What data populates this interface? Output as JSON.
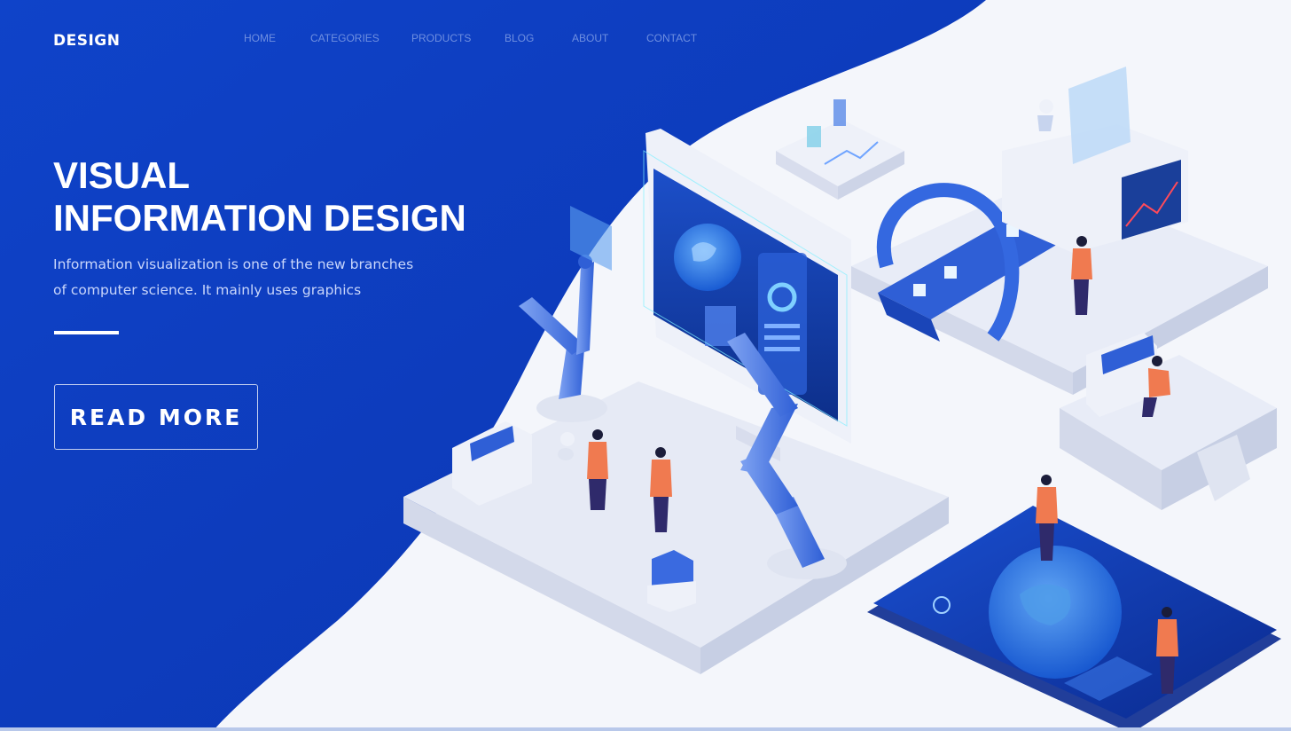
{
  "brand": {
    "logo": "DESIGN"
  },
  "nav": {
    "items": [
      {
        "label": "HOME"
      },
      {
        "label": "CATEGORIES"
      },
      {
        "label": "PRODUCTS"
      },
      {
        "label": "BLOG"
      },
      {
        "label": "ABOUT"
      },
      {
        "label": "CONTACT"
      }
    ]
  },
  "hero": {
    "title_line1": "VISUAL",
    "title_line2": "INFORMATION DESIGN",
    "description_line1": "Information visualization is one of the new branches",
    "description_line2": "of computer science. It mainly uses graphics",
    "cta_label": "READ MORE"
  },
  "colors": {
    "primary_blue": "#0e3fc4",
    "light_bg": "#f4f6fb",
    "accent_orange": "#f07a50"
  },
  "illustration": {
    "icons": [
      "monitor-icon",
      "robot-arm-icon",
      "globe-icon",
      "conveyor-arch-icon",
      "person-icon",
      "chart-panel-icon",
      "server-box-icon"
    ]
  }
}
